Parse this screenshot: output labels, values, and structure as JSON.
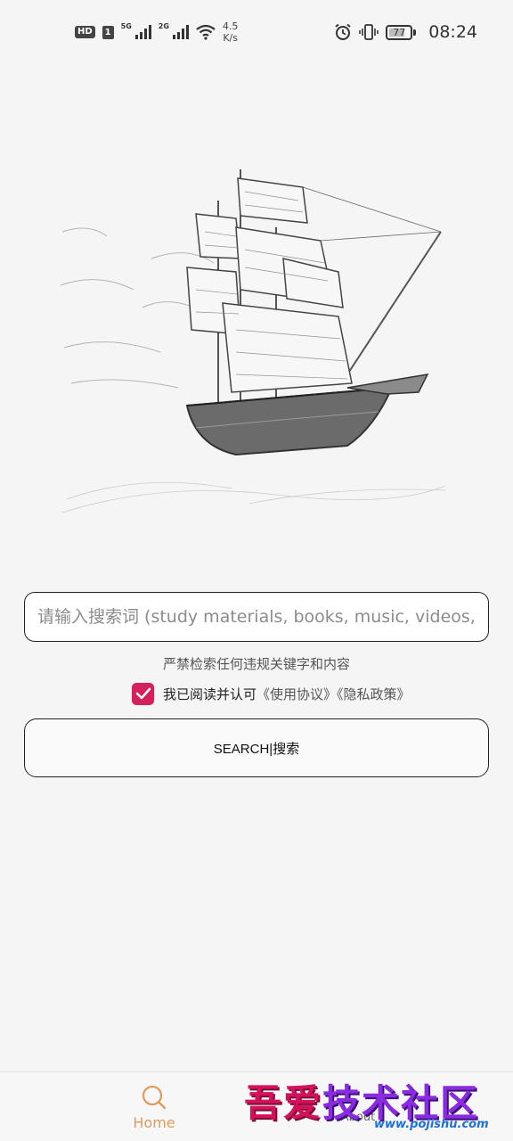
{
  "status_bar": {
    "hd": "HD",
    "sim1": "1",
    "net1": "5G",
    "net2": "2G",
    "speed_value": "4.5",
    "speed_unit": "K/s",
    "battery": "77",
    "battery_percent": 77,
    "time": "08:24"
  },
  "search": {
    "placeholder": "请输入搜索词 (study materials, books, music, videos, ..."
  },
  "notice": "严禁检索任何违规关键字和内容",
  "agreement": {
    "checked": true,
    "text": "我已阅读并认可",
    "terms_link": "《使用协议》",
    "privacy_link": "《隐私政策》"
  },
  "search_button": "SEARCH|搜索",
  "bottom_nav": {
    "home": "Home",
    "about": "About"
  },
  "watermark": {
    "title_part1": "吾爱",
    "title_part2": "技术社区",
    "url": "www.pojishu.com"
  },
  "colors": {
    "accent": "#d4215c",
    "nav_active": "#e09a5c",
    "background": "#f5f5f5"
  }
}
